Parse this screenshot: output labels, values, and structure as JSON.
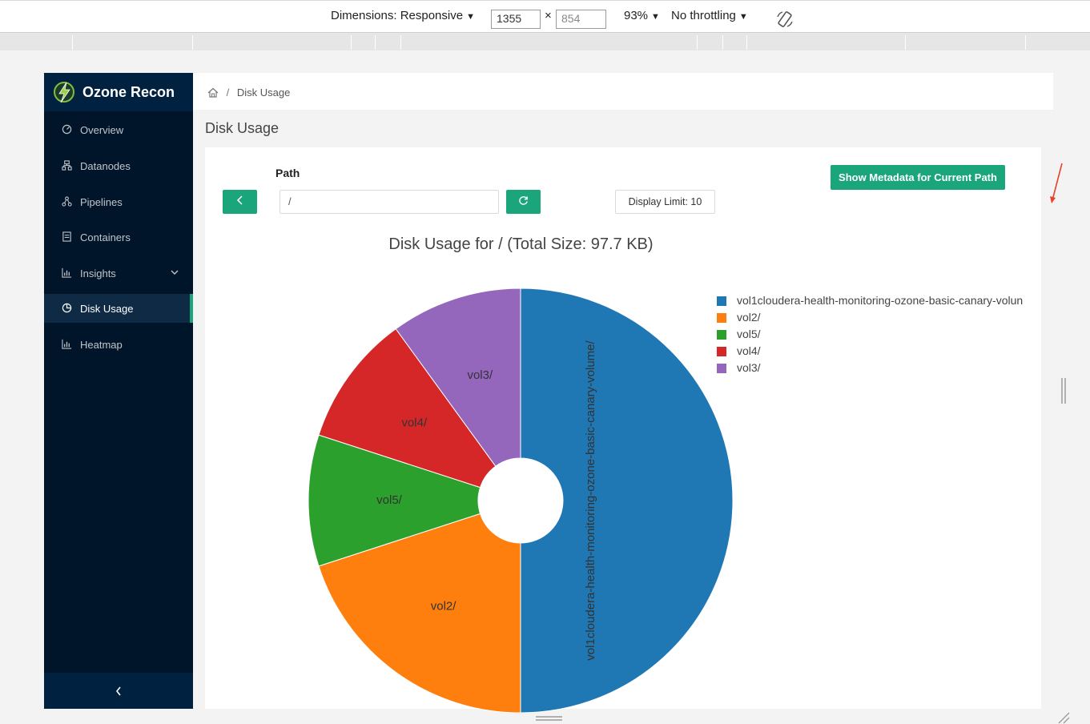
{
  "devtools": {
    "dimensions_label": "Dimensions: Responsive",
    "width_value": "1355",
    "times": "×",
    "height_value": "854",
    "zoom": "93%",
    "throttling": "No throttling",
    "caret": "▼"
  },
  "sidebar": {
    "app_title": "Ozone Recon",
    "items": [
      {
        "label": "Overview",
        "icon": "dashboard-icon"
      },
      {
        "label": "Datanodes",
        "icon": "cluster-icon"
      },
      {
        "label": "Pipelines",
        "icon": "deployment-unit-icon"
      },
      {
        "label": "Containers",
        "icon": "container-icon"
      },
      {
        "label": "Insights",
        "icon": "bar-chart-icon"
      },
      {
        "label": "Disk Usage",
        "icon": "pie-chart-icon",
        "active": true
      },
      {
        "label": "Heatmap",
        "icon": "bar-chart-icon"
      }
    ],
    "collapse_glyph": "‹"
  },
  "breadcrumb": {
    "separator": "/",
    "current": "Disk Usage"
  },
  "page": {
    "title": "Disk Usage",
    "path_label": "Path",
    "path_value": "/",
    "display_limit": "Display Limit: 10",
    "metadata_button": "Show Metadata for Current Path"
  },
  "colors": {
    "accent": "#1aa57a",
    "sidebar_bg": "#001529"
  },
  "chart_data": {
    "type": "pie",
    "title": "Disk Usage for / (Total Size: 97.7 KB)",
    "hole": true,
    "labels": [
      "vol1cloudera-health-monitoring-ozone-basic-canary-volume/",
      "vol2/",
      "vol5/",
      "vol4/",
      "vol3/"
    ],
    "legend_labels": [
      "vol1cloudera-health-monitoring-ozone-basic-canary-volun",
      "vol2/",
      "vol5/",
      "vol4/",
      "vol3/"
    ],
    "values": [
      50,
      20,
      10,
      10,
      10
    ],
    "colors": [
      "#1f77b4",
      "#ff7f0e",
      "#2ca02c",
      "#d62728",
      "#9467bd"
    ],
    "legend_position": "top-right"
  }
}
